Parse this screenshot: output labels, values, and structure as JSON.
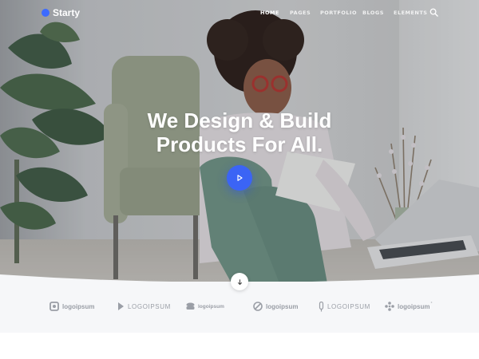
{
  "brand": {
    "name": "Starty",
    "accent": "#3d6bff"
  },
  "nav": {
    "items": [
      {
        "label": "HOME",
        "active": true
      },
      {
        "label": "PAGES",
        "active": false
      },
      {
        "label": "PORTFOLIO",
        "active": false
      },
      {
        "label": "BLOGS",
        "active": false
      },
      {
        "label": "ELEMENTS",
        "active": false
      }
    ],
    "search_icon": "search-icon"
  },
  "hero": {
    "title_line1": "We Design & Build",
    "title_line2": "Products For All.",
    "play_icon": "play-icon",
    "play_color": "#3b64f5",
    "scroll_icon": "arrow-down-icon"
  },
  "logos": [
    {
      "label": "logoipsum",
      "style": "bold"
    },
    {
      "label": "LOGOIPSUM",
      "style": "thin"
    },
    {
      "label": "logoipsum",
      "style": "small"
    },
    {
      "label": "logoipsum",
      "style": "bold"
    },
    {
      "label": "LOGOIPSUM",
      "style": "thin"
    },
    {
      "label": "logoipsum",
      "style": "bold"
    }
  ]
}
